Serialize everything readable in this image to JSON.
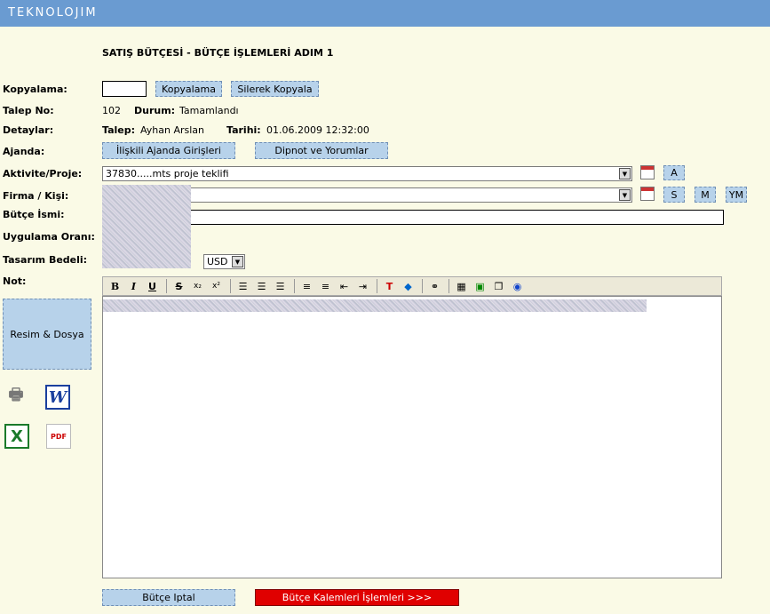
{
  "app": {
    "logo": "TEKNOLOJIM"
  },
  "page": {
    "title": "SATIŞ BÜTÇESİ - BÜTÇE İŞLEMLERİ ADIM 1"
  },
  "labels": {
    "kopyalama": "Kopyalama:",
    "talep_no": "Talep No:",
    "detaylar": "Detaylar:",
    "ajanda": "Ajanda:",
    "aktivite": "Aktivite/Proje:",
    "firma": "Firma / Kişi:",
    "butce_ismi": "Bütçe İsmi:",
    "uygulama": "Uygulama Oranı:",
    "tasarim": "Tasarım Bedeli:",
    "not": "Not:",
    "durum": "Durum:",
    "talep": "Talep:",
    "tarihi": "Tarihi:"
  },
  "values": {
    "talep_no": "102",
    "durum": "Tamamlandı",
    "talep": "Ayhan Arslan",
    "tarihi": "01.06.2009 12:32:00",
    "aktivite": "37830.....mts proje teklifi",
    "currency": "USD"
  },
  "buttons": {
    "kopyalama": "Kopyalama",
    "silerek": "Silerek Kopyala",
    "iliskili": "İlişkili Ajanda Girişleri",
    "dipnot": "Dipnot ve Yorumlar",
    "a": "A",
    "s": "S",
    "m": "M",
    "ym": "YM",
    "resim": "Resim & Dosya",
    "iptal": "Bütçe Iptal",
    "kalemler": "Bütçe Kalemleri İşlemleri >>>"
  },
  "toolbar": {
    "bold": "B",
    "italic": "I",
    "underline": "U",
    "strike": "S",
    "sub": "x₂",
    "sup": "x²"
  },
  "colors": {
    "topbar": "#6a9bd1",
    "button": "#b7d2ea",
    "primary_action": "#e00000",
    "background": "#fafae6"
  }
}
